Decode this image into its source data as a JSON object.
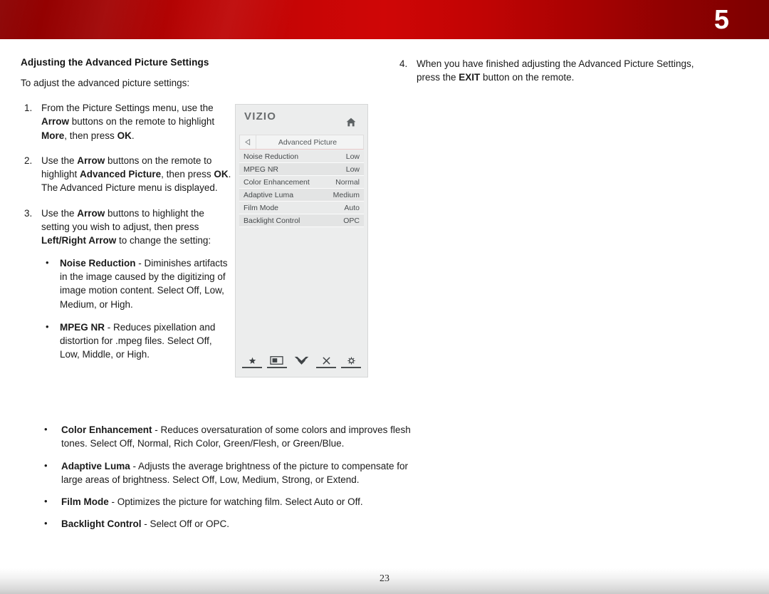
{
  "header": {
    "chapter_number": "5",
    "accent_color": "#c80505",
    "accent_color_dark": "#8b0000"
  },
  "footer": {
    "page_number": "23"
  },
  "left_column": {
    "section_title": "Adjusting the Advanced Picture Settings",
    "lead_text": "To adjust the advanced picture settings:",
    "steps": [
      {
        "number": "1.",
        "parts": [
          {
            "text": "From the Picture Settings menu, use the ",
            "bold": false
          },
          {
            "text": "Arrow",
            "bold": true
          },
          {
            "text": " buttons on the remote to highlight ",
            "bold": false
          },
          {
            "text": "More",
            "bold": true
          },
          {
            "text": ", then press ",
            "bold": false
          },
          {
            "text": "OK",
            "bold": true
          },
          {
            "text": ".",
            "bold": false
          }
        ]
      },
      {
        "number": "2.",
        "parts": [
          {
            "text": "Use the ",
            "bold": false
          },
          {
            "text": "Arrow",
            "bold": true
          },
          {
            "text": " buttons on the remote to highlight ",
            "bold": false
          },
          {
            "text": "Advanced Picture",
            "bold": true
          },
          {
            "text": ", then press ",
            "bold": false
          },
          {
            "text": "OK",
            "bold": true
          },
          {
            "text": ". The Advanced Picture menu is displayed.",
            "bold": false
          }
        ]
      },
      {
        "number": "3.",
        "parts": [
          {
            "text": "Use the ",
            "bold": false
          },
          {
            "text": "Arrow",
            "bold": true
          },
          {
            "text": " buttons to highlight the setting you wish to adjust, then press ",
            "bold": false
          },
          {
            "text": "Left/Right Arrow",
            "bold": true
          },
          {
            "text": " to change the setting:",
            "bold": false
          }
        ]
      }
    ],
    "narrow_bullets": [
      {
        "term": "Noise Reduction",
        "description": " - Diminishes artifacts in the image caused by the digitizing of image motion content. Select Off, Low, Medium, or High."
      },
      {
        "term": "MPEG NR",
        "description": " - Reduces pixellation and distortion for .mpeg files. Select Off, Low, Middle, or High."
      }
    ]
  },
  "right_column": {
    "steps": [
      {
        "number": "4.",
        "parts": [
          {
            "text": "When you have finished adjusting the Advanced Picture Settings, press the ",
            "bold": false
          },
          {
            "text": "EXIT",
            "bold": true
          },
          {
            "text": " button on the remote.",
            "bold": false
          }
        ]
      }
    ]
  },
  "wide_bullets": [
    {
      "term": "Color Enhancement",
      "description": " - Reduces oversaturation of some colors and improves flesh tones. Select Off, Normal, Rich Color, Green/Flesh, or Green/Blue."
    },
    {
      "term": "Adaptive Luma",
      "description": " - Adjusts the average brightness of the picture to compensate for large areas of brightness. Select Off, Low, Medium, Strong, or Extend."
    },
    {
      "term": "Film Mode",
      "description": " - Optimizes the picture for watching film. Select Auto or Off."
    },
    {
      "term": "Backlight Control",
      "description": " - Select Off or OPC."
    }
  ],
  "osd_menu": {
    "brand": "VIZIO",
    "home_icon": "home-icon",
    "back_icon": "back-arrow-icon",
    "title": "Advanced Picture",
    "rows": [
      {
        "label": "Noise Reduction",
        "value": "Low"
      },
      {
        "label": "MPEG NR",
        "value": "Low"
      },
      {
        "label": "Color Enhancement",
        "value": "Normal"
      },
      {
        "label": "Adaptive Luma",
        "value": "Medium"
      },
      {
        "label": "Film Mode",
        "value": "Auto"
      },
      {
        "label": "Backlight Control",
        "value": "OPC"
      }
    ],
    "icon_bar": [
      {
        "name": "star-icon"
      },
      {
        "name": "picture-icon"
      },
      {
        "name": "double-chevron-down-icon"
      },
      {
        "name": "close-x-icon"
      },
      {
        "name": "gear-icon"
      }
    ]
  }
}
